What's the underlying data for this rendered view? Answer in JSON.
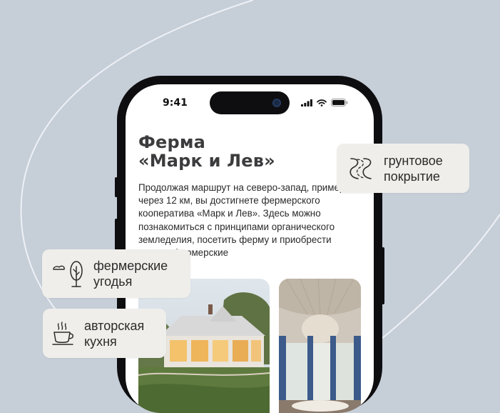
{
  "status": {
    "time": "9:41"
  },
  "card": {
    "title_line1": "Ферма",
    "title_line2": "«Марк и Лев»",
    "description": "Продолжая маршрут на северо-запад, примерно через 12 км, вы достигнете фермерского кооператива «Марк и Лев». Здесь можно познакомиться с принципами органического земледелия, посетить ферму и приобрести свежие фермерские"
  },
  "chips": {
    "road": {
      "line1": "грунтовое",
      "line2": "покрытие",
      "icon": "winding-road-icon"
    },
    "farm": {
      "line1": "фермерские",
      "line2": "угодья",
      "icon": "tree-icon"
    },
    "kitchen": {
      "line1": "авторская",
      "line2": "кухня",
      "icon": "coffee-cup-icon"
    }
  },
  "colors": {
    "background": "#c6ced8",
    "phone_frame": "#0e0e10",
    "chip": "#efeeea",
    "title": "#3c3c3e"
  }
}
